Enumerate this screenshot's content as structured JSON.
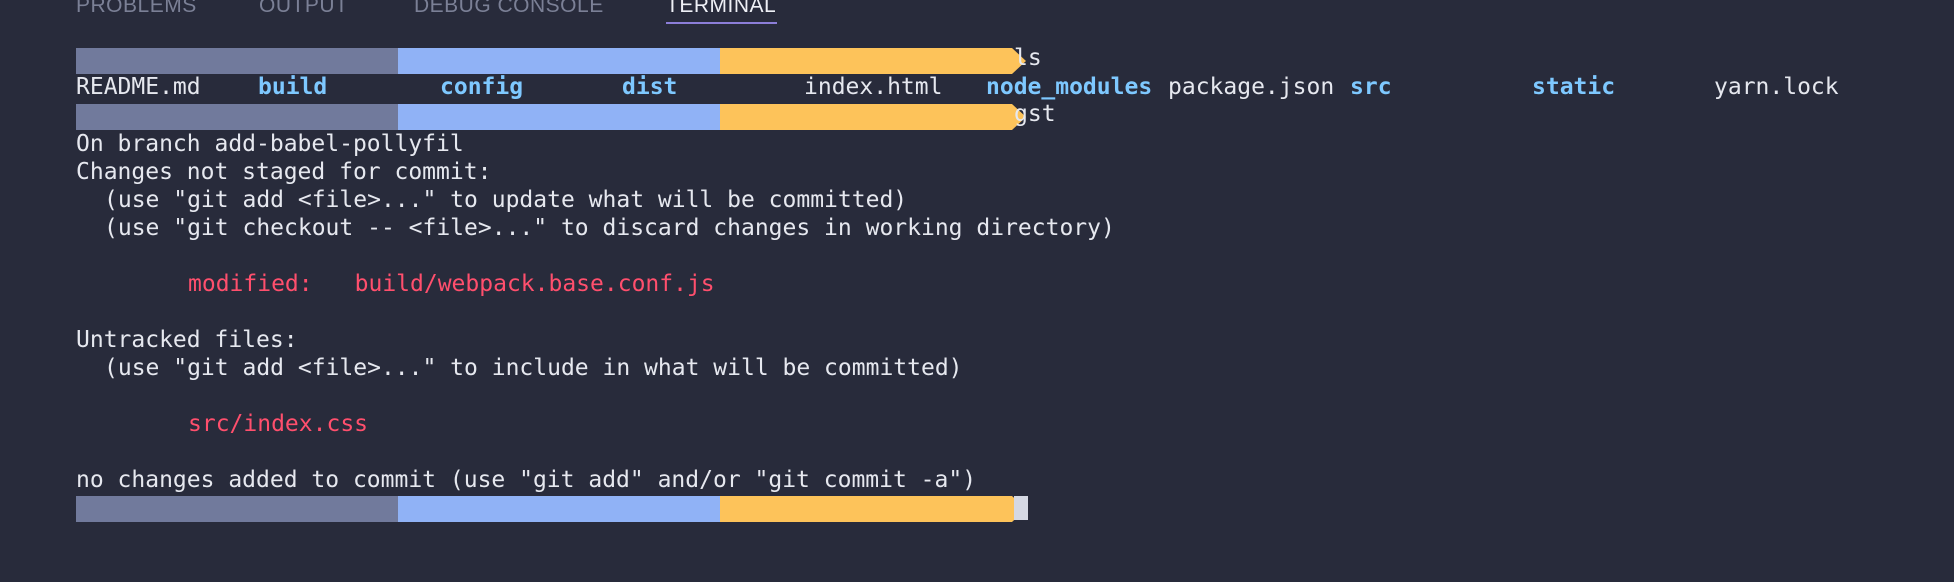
{
  "panel": {
    "tabs": [
      {
        "label": "PROBLEMS",
        "active": false
      },
      {
        "label": "OUTPUT",
        "active": false
      },
      {
        "label": "DEBUG CONSOLE",
        "active": false
      },
      {
        "label": "TERMINAL",
        "active": true
      }
    ]
  },
  "colors": {
    "background": "#282b3b",
    "text": "#e6e8ef",
    "directory": "#7ec8ff",
    "modified": "#ff4f6d",
    "prompt_segment_user": "#717a9c",
    "prompt_segment_path": "#90b2f6",
    "prompt_segment_git": "#fdc35a",
    "active_tab_underline": "#8c7ed8"
  },
  "terminal": {
    "prompts": [
      {
        "command": "ls"
      },
      {
        "command": "gst"
      },
      {
        "command": ""
      }
    ],
    "ls_output": [
      {
        "name": "README.md",
        "type": "file"
      },
      {
        "name": "build",
        "type": "dir"
      },
      {
        "name": "config",
        "type": "dir"
      },
      {
        "name": "dist",
        "type": "dir"
      },
      {
        "name": "index.html",
        "type": "file"
      },
      {
        "name": "node_modules",
        "type": "dir"
      },
      {
        "name": "package.json",
        "type": "file"
      },
      {
        "name": "src",
        "type": "dir"
      },
      {
        "name": "static",
        "type": "dir"
      },
      {
        "name": "yarn.lock",
        "type": "file"
      }
    ],
    "git_status": {
      "branch_line": "On branch add-babel-pollyfil",
      "unstaged_header": "Changes not staged for commit:",
      "unstaged_hint_1": "(use \"git add <file>...\" to update what will be committed)",
      "unstaged_hint_2": "(use \"git checkout -- <file>...\" to discard changes in working directory)",
      "modified_label": "modified:",
      "modified_file": "build/webpack.base.conf.js",
      "untracked_header": "Untracked files:",
      "untracked_hint": "(use \"git add <file>...\" to include in what will be committed)",
      "untracked_file": "src/index.css",
      "summary": "no changes added to commit (use \"git add\" and/or \"git commit -a\")"
    }
  }
}
